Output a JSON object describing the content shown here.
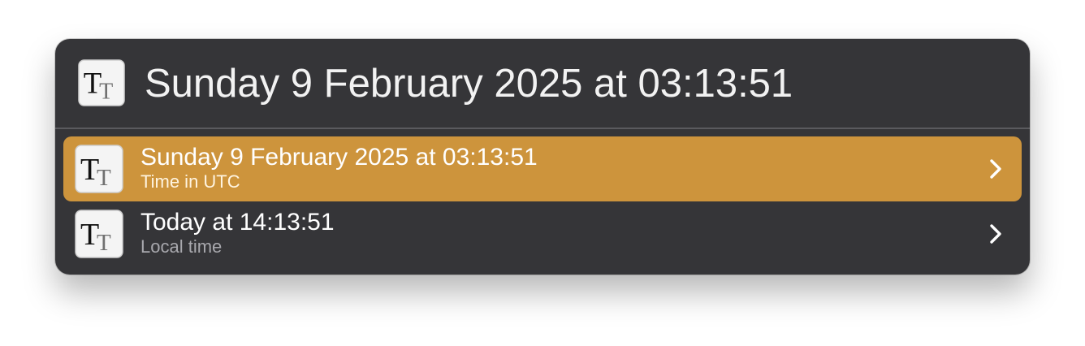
{
  "header": {
    "icon": "text-tt-icon",
    "title": "Sunday 9 February 2025 at 03:13:51"
  },
  "results": [
    {
      "title": "Sunday 9 February 2025 at 03:13:51",
      "subtitle": "Time in UTC",
      "selected": true,
      "icon": "text-tt-icon"
    },
    {
      "title": "Today at 14:13:51",
      "subtitle": "Local time",
      "selected": false,
      "icon": "text-tt-icon"
    }
  ],
  "colors": {
    "window_background": "#353538",
    "selection": "#cd943c",
    "primary_text": "#ffffff",
    "secondary_text": "#a8a8ad"
  },
  "icons": {
    "result_arrow": "chevron-right-icon"
  }
}
